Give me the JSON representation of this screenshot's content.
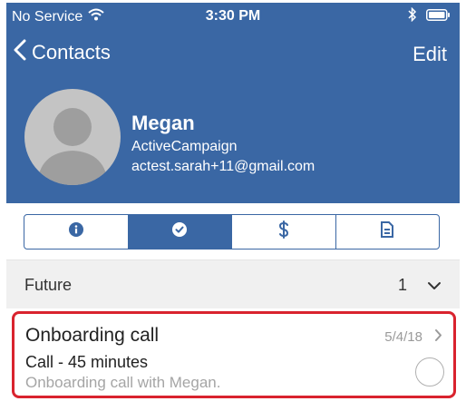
{
  "status_bar": {
    "carrier": "No Service",
    "time": "3:30 PM"
  },
  "nav": {
    "back_label": "Contacts",
    "edit_label": "Edit"
  },
  "contact": {
    "name": "Megan",
    "company": "ActiveCampaign",
    "email": "actest.sarah+11@gmail.com"
  },
  "tabs": [
    {
      "icon": "info-icon",
      "active": false
    },
    {
      "icon": "checkmark-icon",
      "active": true
    },
    {
      "icon": "dollar-icon",
      "active": false
    },
    {
      "icon": "document-icon",
      "active": false
    }
  ],
  "section": {
    "label": "Future",
    "count": "1"
  },
  "task": {
    "title": "Onboarding call",
    "date": "5/4/18",
    "type": "Call - 45 minutes",
    "description": "Onboarding call with Megan."
  },
  "colors": {
    "brand_blue": "#3a67a4",
    "highlight_red": "#d9232e"
  }
}
